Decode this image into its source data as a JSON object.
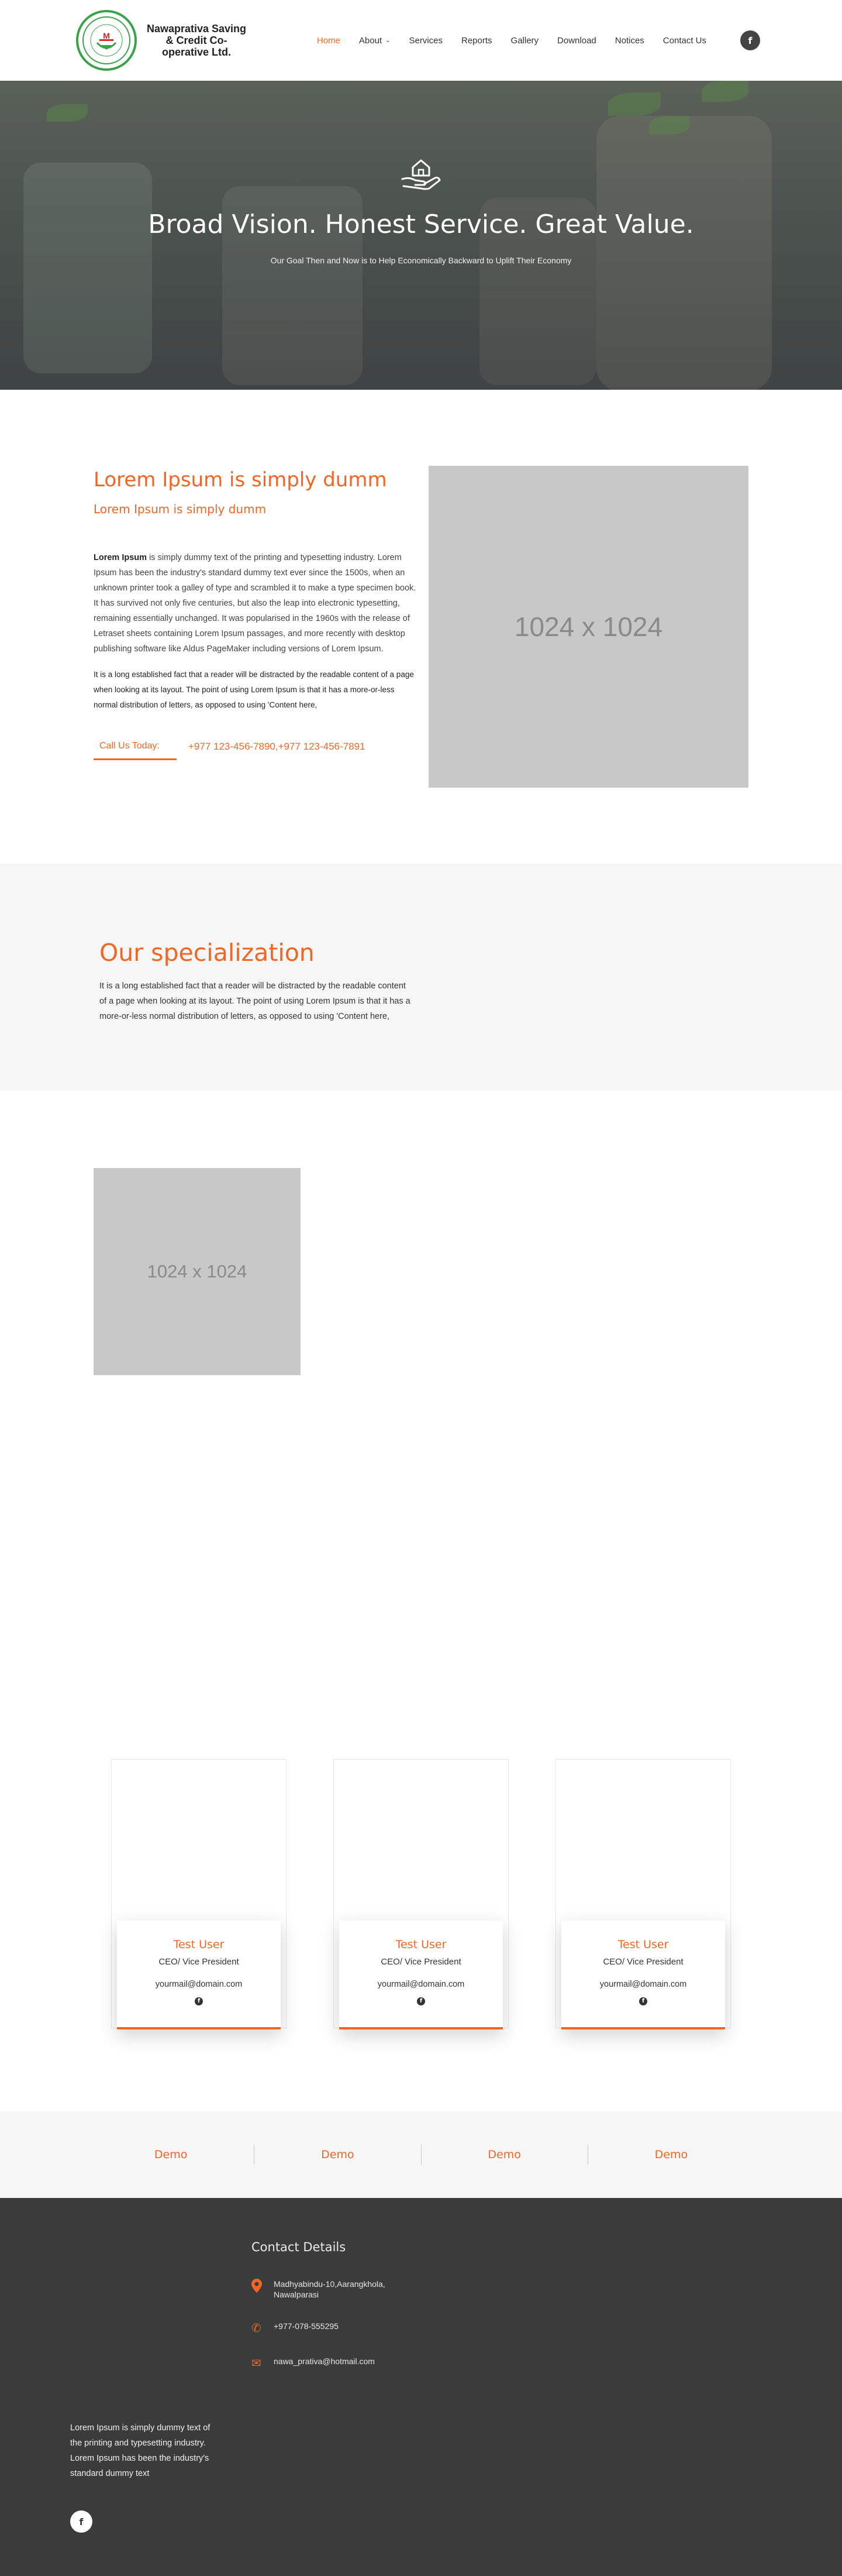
{
  "header": {
    "logo_text": "Nawaprativa Saving & Credit Co-operative Ltd.",
    "nav": [
      {
        "label": "Home",
        "active": true
      },
      {
        "label": "About",
        "dropdown": true
      },
      {
        "label": "Services"
      },
      {
        "label": "Reports"
      },
      {
        "label": "Gallery"
      },
      {
        "label": "Download"
      },
      {
        "label": "Notices"
      },
      {
        "label": "Contact Us"
      }
    ],
    "social_icon": "facebook-icon",
    "social_glyph": "f",
    "dropdown_glyph": "⌄"
  },
  "hero": {
    "title": "Broad Vision. Honest Service. Great Value.",
    "subtitle": "Our Goal Then and Now is to Help Economically Backward to Uplift Their Economy",
    "icon": "hand-house-icon"
  },
  "about": {
    "title": "Lorem Ipsum is simply dumm",
    "subtitle": "Lorem Ipsum is simply dumm",
    "lead_bold": "Lorem Ipsum",
    "lead_rest": " is simply dummy text of the printing and typesetting industry. Lorem Ipsum has been the industry's standard dummy text ever since the 1500s, when an unknown printer took a galley of type and scrambled it to make a type specimen book. It has survived not only five centuries, but also the leap into electronic typesetting, remaining essentially unchanged. It was popularised in the 1960s with the release of Letraset sheets containing Lorem Ipsum passages, and more recently with desktop publishing software like Aldus PageMaker including versions of Lorem Ipsum.",
    "second": "It is a long established fact that a reader will be distracted by the readable content of a page when looking at its layout. The point of using Lorem Ipsum is that it has a more-or-less normal distribution of letters, as opposed to using 'Content here,",
    "call_label": "Call Us Today:",
    "call_numbers": "+977 123-456-7890,+977 123-456-7891",
    "image_label": "1024 x 1024"
  },
  "specialization": {
    "title": "Our specialization",
    "text": "It is a long established fact that a reader will be distracted by the readable content of a page when looking at its layout. The point of using Lorem Ipsum is that it has a more-or-less normal distribution of letters, as opposed to using 'Content here,"
  },
  "gallery": {
    "image_label": "1024 x 1024"
  },
  "team": [
    {
      "name": "Test User",
      "role": "CEO/ Vice President",
      "email": "yourmail@domain.com",
      "social": "facebook-icon"
    },
    {
      "name": "Test User",
      "role": "CEO/ Vice President",
      "email": "yourmail@domain.com",
      "social": "facebook-icon"
    },
    {
      "name": "Test User",
      "role": "CEO/ Vice President",
      "email": "yourmail@domain.com",
      "social": "facebook-icon"
    }
  ],
  "demo": [
    "Demo",
    "Demo",
    "Demo",
    "Demo"
  ],
  "footer": {
    "contact_title": "Contact Details",
    "address": "Madhyabindu-10,Aarangkhola, Nawalparasi",
    "phone": "+977-078-555295",
    "email": "nawa_prativa@hotmail.com",
    "about": "Lorem Ipsum is simply dummy text of the printing and typesetting industry. Lorem Ipsum has been the industry's standard dummy text",
    "icons": {
      "address": "map-pin-icon",
      "phone": "phone-icon",
      "email": "envelope-icon"
    },
    "glyphs": {
      "address": "⬤",
      "phone": "✆",
      "email": "✉"
    }
  },
  "colors": {
    "accent": "#f26522",
    "logo_green": "#3aa349",
    "footer_bg": "#3b3b3b",
    "light_bg": "#f6f6f6",
    "placeholder": "#c8c8c8"
  }
}
